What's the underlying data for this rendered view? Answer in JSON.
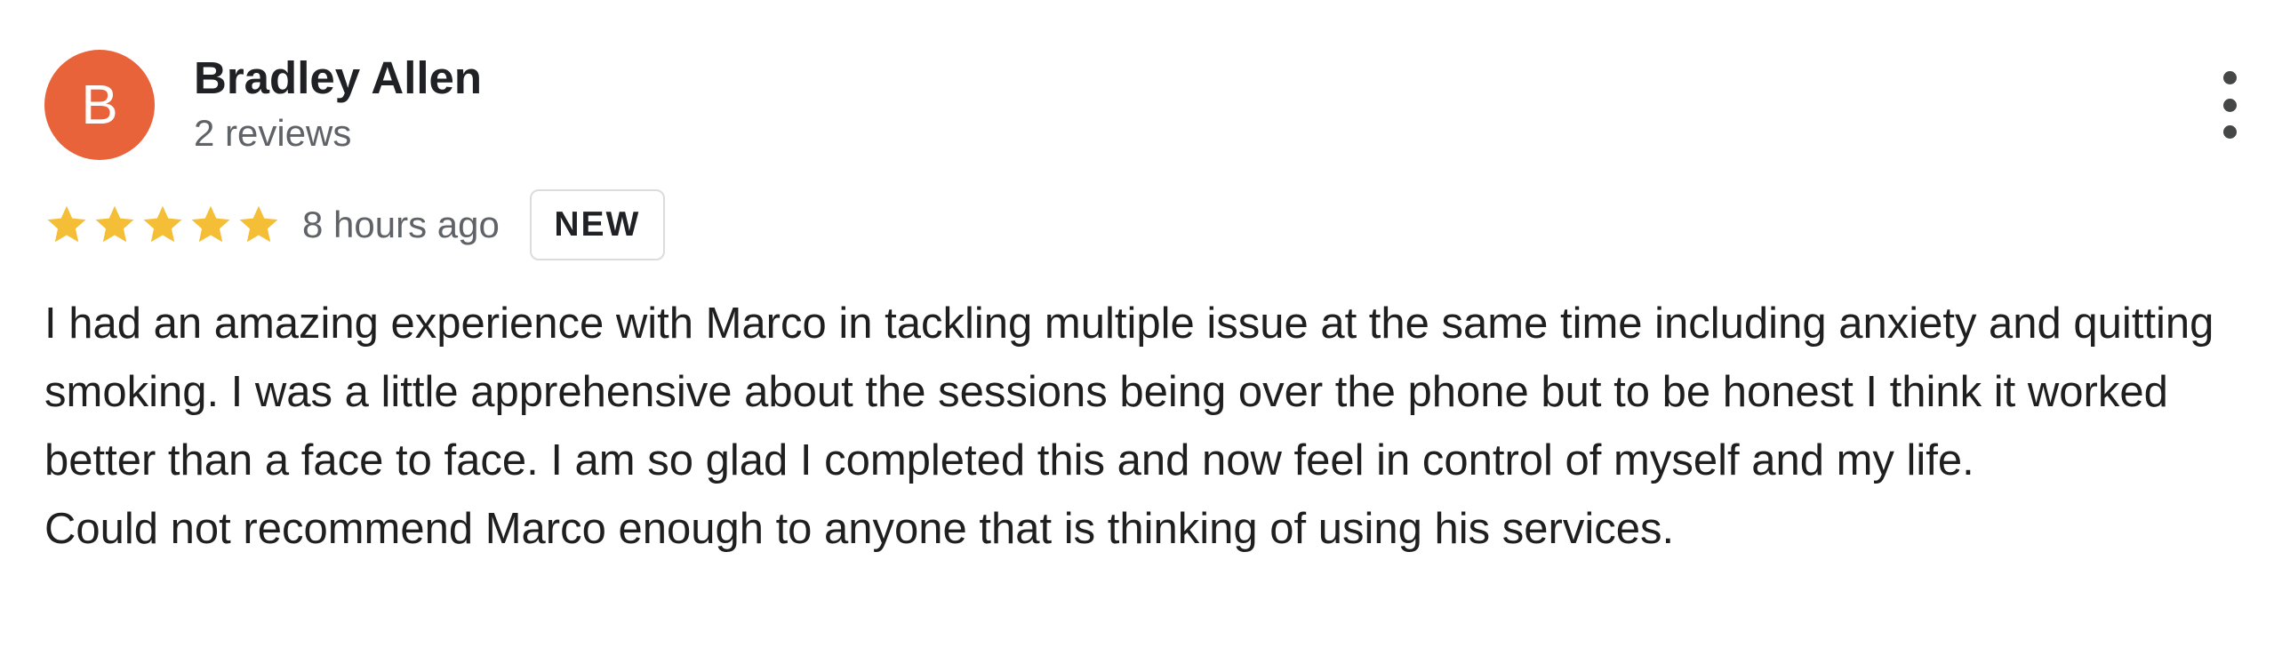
{
  "review": {
    "avatar": {
      "initial": "B",
      "color": "#e8623a"
    },
    "reviewer_name": "Bradley Allen",
    "review_count": "2 reviews",
    "rating": {
      "value": 5,
      "max": 5,
      "star_color": "#f5be37"
    },
    "time": "8 hours ago",
    "badge": "NEW",
    "more_icon": "more-vertical-icon",
    "text": "I had an amazing experience with Marco in tackling multiple issue at the same time including anxiety and quitting smoking. I was a little apprehensive about the sessions being over the phone but to be honest I think it worked better than a face to face. I am so glad I completed this and now feel in control of myself and my life.\nCould not recommend Marco enough to anyone that is thinking of using his services."
  }
}
